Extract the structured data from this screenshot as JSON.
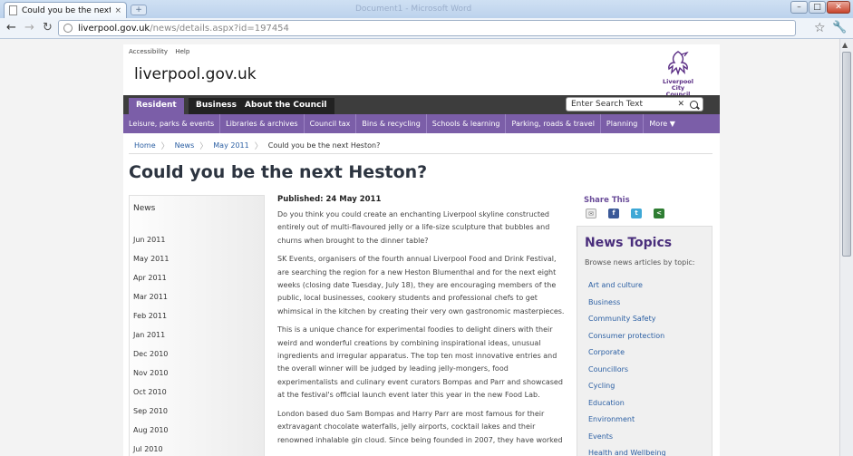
{
  "browser": {
    "tab_title": "Could you be the next He...",
    "tab_close": "×",
    "new_tab": "+",
    "ghost_title": "Document1 - Microsoft Word",
    "window_buttons": {
      "minimize": "–",
      "maximize": "□",
      "close": "✕"
    },
    "url_domain": "liverpool.gov.uk",
    "url_path": "/news/details.aspx?id=197454",
    "back": "←",
    "forward": "→",
    "reload": "↻",
    "star": "☆",
    "wrench": "🔧"
  },
  "site": {
    "util_links": [
      "Accessibility",
      "Help"
    ],
    "name": "liverpool.gov.uk",
    "logo_text": [
      "Liverpool",
      "City Council"
    ],
    "colors": {
      "purple": "#7b5ea8",
      "nav_dark": "#3d3d3d",
      "link": "#2b5fa3"
    }
  },
  "main_nav": {
    "tabs": [
      "Resident",
      "Business",
      "About the Council"
    ],
    "active": "Resident",
    "search_placeholder": "Enter Search Text",
    "search_clear": "✕"
  },
  "sub_nav": [
    "Leisure, parks & events",
    "Libraries & archives",
    "Council tax",
    "Bins & recycling",
    "Schools & learning",
    "Parking, roads & travel",
    "Planning",
    "More ▼"
  ],
  "breadcrumb": [
    "Home",
    "News",
    "May 2011",
    "Could you be the next Heston?"
  ],
  "breadcrumb_sep": "〉",
  "article": {
    "title": "Could you be the next Heston?",
    "published": "Published: 24 May 2011",
    "paragraphs": [
      "Do you think you could create an enchanting Liverpool skyline constructed entirely out of multi-flavoured jelly or a life-size sculpture that bubbles and churns when brought to the dinner table?",
      "SK Events, organisers of the fourth annual Liverpool Food and Drink Festival, are searching the region for a new Heston Blumenthal and for the next eight weeks (closing date Tuesday, July 18), they are encouraging members of the public, local businesses, cookery students and professional chefs to get whimsical in the kitchen by creating their very own gastronomic masterpieces.",
      "This is a unique chance for experimental foodies to delight diners with their weird and wonderful creations by combining inspirational ideas, unusual ingredients and irregular apparatus. The top ten most innovative entries and the overall winner will be judged by leading jelly-mongers, food experimentalists and culinary event curators Bompas and Parr and showcased at the festival's official launch event later this year in the new Food Lab.",
      "London based duo Sam Bompas and Harry Parr are most famous for their extravagant chocolate waterfalls, jelly airports, cocktail lakes and their renowned inhalable gin cloud. Since being founded in 2007, they have worked"
    ]
  },
  "archive": {
    "heading": "News",
    "months": [
      "Jun 2011",
      "May 2011",
      "Apr 2011",
      "Mar 2011",
      "Feb 2011",
      "Jan 2011",
      "Dec 2010",
      "Nov 2010",
      "Oct 2010",
      "Sep 2010",
      "Aug 2010",
      "Jul 2010"
    ]
  },
  "share": {
    "title": "Share This",
    "icons": [
      "email-icon",
      "facebook-icon",
      "twitter-icon",
      "sharethis-icon"
    ],
    "glyphs": [
      "✉",
      "f",
      "t",
      "<"
    ]
  },
  "topics": {
    "title": "News Topics",
    "subtitle": "Browse news articles by topic:",
    "items": [
      "Art and culture",
      "Business",
      "Community Safety",
      "Consumer protection",
      "Corporate",
      "Councillors",
      "Cycling",
      "Education",
      "Environment",
      "Events",
      "Health and Wellbeing"
    ]
  }
}
